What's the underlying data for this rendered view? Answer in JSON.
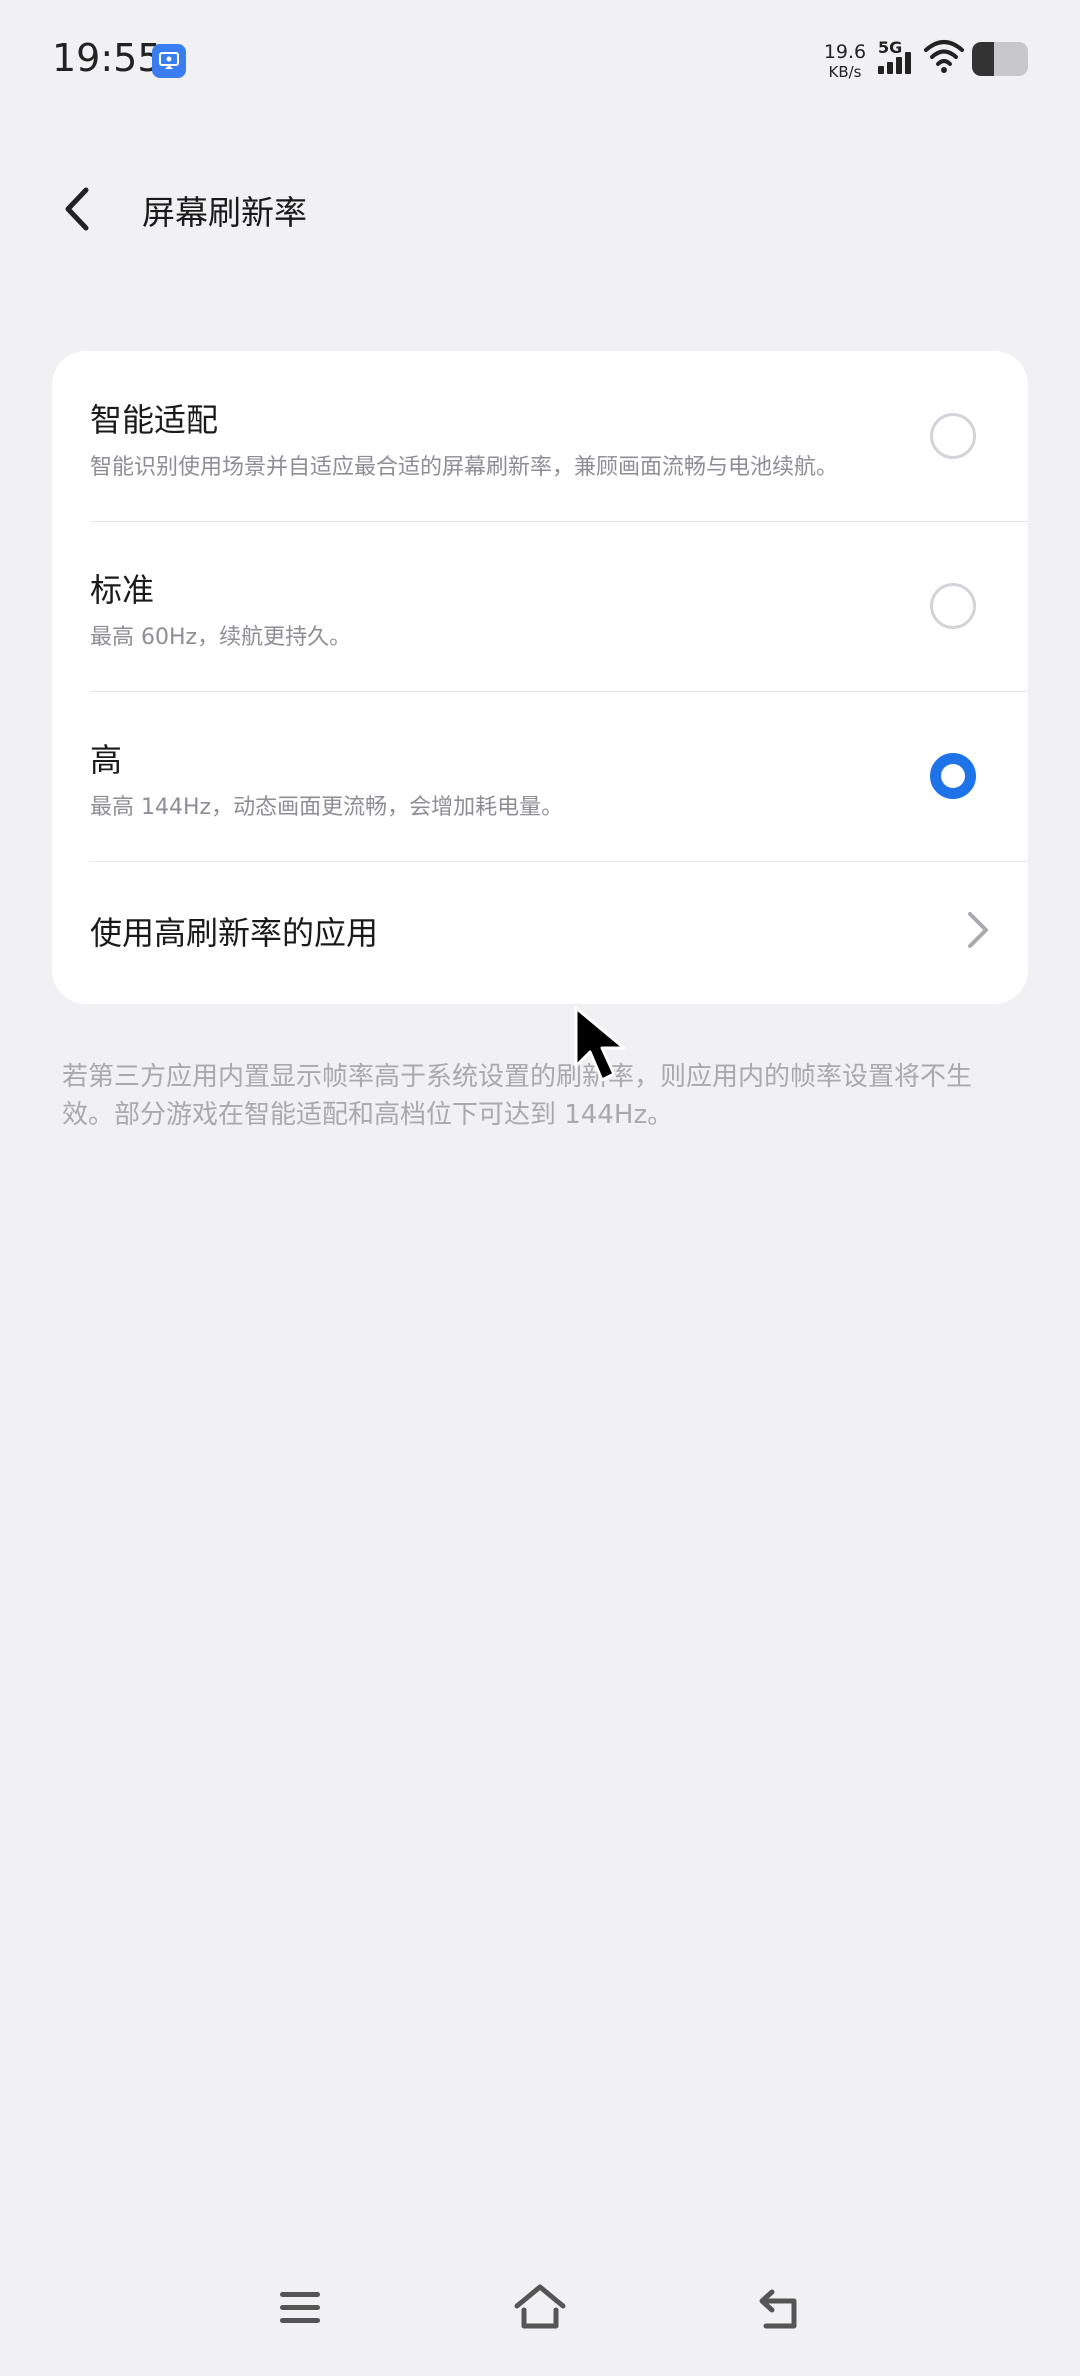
{
  "status_bar": {
    "time": "19:55",
    "net_speed_value": "19.6",
    "net_speed_unit": "KB/s",
    "network_type": "5G",
    "app_icon": "screen-cast-icon",
    "battery_level": 0.4
  },
  "header": {
    "title": "屏幕刷新率",
    "back_icon": "chevron-left-icon"
  },
  "options": [
    {
      "title": "智能适配",
      "desc": "智能识别使用场景并自适应最合适的屏幕刷新率，兼顾画面流畅与电池续航。",
      "selected": false
    },
    {
      "title": "标准",
      "desc": "最高 60Hz，续航更持久。",
      "selected": false
    },
    {
      "title": "高",
      "desc": "最高 144Hz，动态画面更流畅，会增加耗电量。",
      "selected": true
    }
  ],
  "apps_row": {
    "label": "使用高刷新率的应用",
    "icon": "chevron-right-icon"
  },
  "footnote": "若第三方应用内置显示帧率高于系统设置的刷新率，则应用内的帧率设置将不生效。部分游戏在智能适配和高档位下可达到 144Hz。",
  "colors": {
    "accent": "#1f73e8",
    "background": "#f1f1f3",
    "card": "#ffffff",
    "secondary_text": "#8e8e93"
  },
  "nav_bar": {
    "menu_icon": "menu-icon",
    "home_icon": "home-icon",
    "back_icon": "back-icon"
  }
}
